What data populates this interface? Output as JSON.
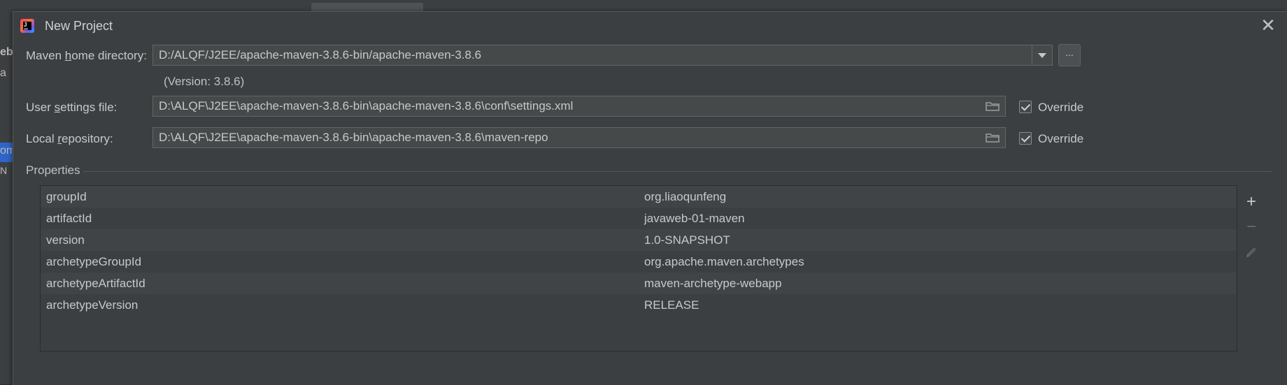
{
  "dialog": {
    "title": "New Project",
    "close_glyph": "✕"
  },
  "maven_home": {
    "label_pre": "Maven ",
    "label_mnemonic": "h",
    "label_post": "ome directory:",
    "value": "D:/ALQF/J2EE/apache-maven-3.8.6-bin/apache-maven-3.8.6",
    "version_note": "(Version: 3.8.6)",
    "browse_label": "..."
  },
  "user_settings": {
    "label_pre": "User ",
    "label_mnemonic": "s",
    "label_post": "ettings file:",
    "value": "D:\\ALQF\\J2EE\\apache-maven-3.8.6-bin\\apache-maven-3.8.6\\conf\\settings.xml",
    "override_label": "Override",
    "override_checked": true
  },
  "local_repo": {
    "label_pre": "Local ",
    "label_mnemonic": "r",
    "label_post": "epository:",
    "value": "D:\\ALQF\\J2EE\\apache-maven-3.8.6-bin\\apache-maven-3.8.6\\maven-repo",
    "override_label": "Override",
    "override_checked": true
  },
  "properties": {
    "section_title": "Properties",
    "rows": [
      {
        "key": "groupId",
        "value": "org.liaoqunfeng"
      },
      {
        "key": "artifactId",
        "value": "javaweb-01-maven"
      },
      {
        "key": "version",
        "value": "1.0-SNAPSHOT"
      },
      {
        "key": "archetypeGroupId",
        "value": "org.apache.maven.archetypes"
      },
      {
        "key": "archetypeArtifactId",
        "value": "maven-archetype-webapp"
      },
      {
        "key": "archetypeVersion",
        "value": "RELEASE"
      }
    ],
    "toolbar": {
      "add_icon": "plus-icon",
      "remove_icon": "minus-icon",
      "edit_icon": "pencil-icon",
      "add_glyph": "+",
      "remove_glyph": "−"
    }
  },
  "background": {
    "left_fragments": [
      "eb",
      "a",
      "om",
      "N"
    ]
  },
  "colors": {
    "dialog_bg": "#3c3f41",
    "field_bg": "#45494a",
    "text": "#c8c8c8",
    "selection": "#2f65ca"
  }
}
